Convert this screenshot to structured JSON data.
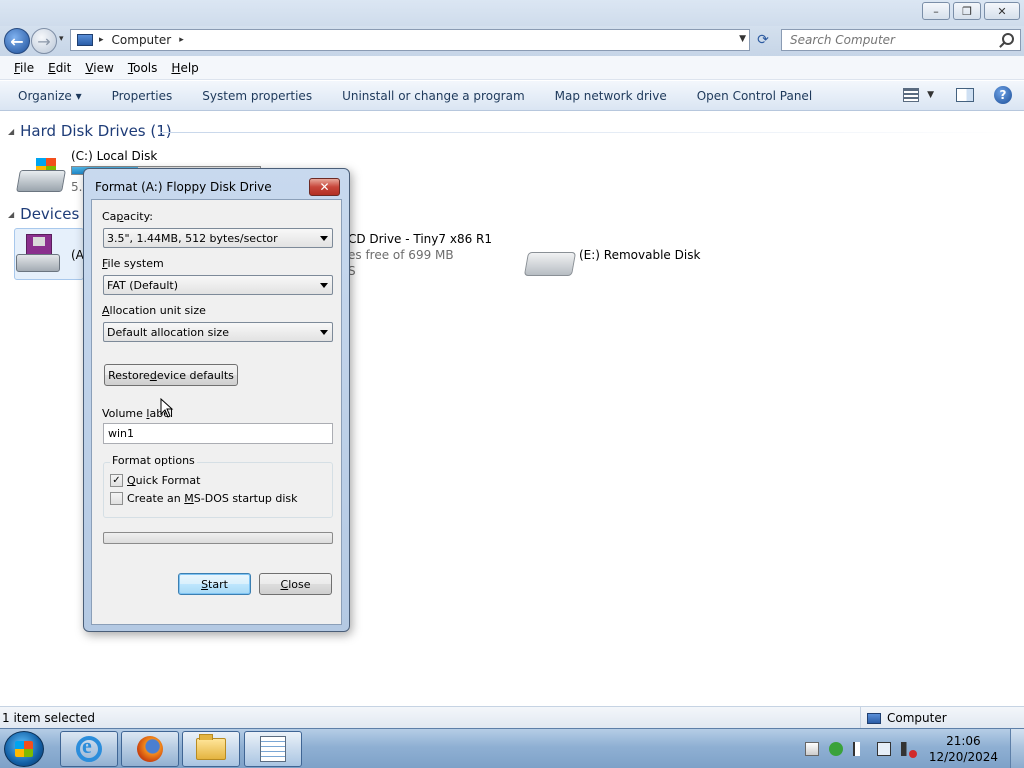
{
  "window": {
    "minimize_glyph": "–",
    "maximize_glyph": "❐",
    "close_glyph": "✕"
  },
  "address_bar": {
    "back_glyph": "←",
    "forward_glyph": "→",
    "path": [
      "Computer"
    ],
    "separator": "▸",
    "refresh_glyph": "⟳",
    "search_placeholder": "Search Computer"
  },
  "menu": {
    "items": [
      {
        "key": "F",
        "rest": "ile"
      },
      {
        "key": "E",
        "rest": "dit"
      },
      {
        "key": "V",
        "rest": "iew"
      },
      {
        "key": "T",
        "rest": "ools"
      },
      {
        "key": "H",
        "rest": "elp"
      }
    ]
  },
  "command_bar": {
    "organize": "Organize ▾",
    "items": [
      "Properties",
      "System properties",
      "Uninstall or change a program",
      "Map network drive",
      "Open Control Panel"
    ],
    "help_glyph": "?"
  },
  "content": {
    "group_hdd": "Hard Disk Drives (1)",
    "drive_c_name": "(C:) Local Disk",
    "drive_c_size_partial": "5.4",
    "drive_c_usage": 0.35,
    "group_devices_partial": "Devices w",
    "floppy_name_partial": "(A",
    "cd_name_partial": "CD Drive - Tiny7 x86 R1",
    "cd_free_partial": "es free of 699 MB",
    "cd_fs_partial": "S",
    "removable_name": "(E:) Removable Disk"
  },
  "dialog": {
    "title": "Format (A:) Floppy Disk Drive",
    "close_glyph": "✕",
    "capacity_label_pre": "Ca",
    "capacity_label_key": "p",
    "capacity_label_post": "acity:",
    "capacity_value": "3.5\",  1.44MB, 512 bytes/sector",
    "filesystem_label_key": "F",
    "filesystem_label_post": "ile system",
    "filesystem_value": "FAT (Default)",
    "alloc_label_key": "A",
    "alloc_label_post": "llocation unit size",
    "alloc_value": "Default allocation size",
    "restore_pre": "Restore ",
    "restore_key": "d",
    "restore_post": "evice defaults",
    "volume_label_pre": "Volume ",
    "volume_label_key": "l",
    "volume_label_post": "abel",
    "volume_value": "win1",
    "format_options_title": "Format options",
    "quick_format_pre": "",
    "quick_format_key": "Q",
    "quick_format_post": "uick Format",
    "quick_format_checked": true,
    "msdos_pre": "Create an ",
    "msdos_key": "M",
    "msdos_post": "S-DOS startup disk",
    "msdos_checked": false,
    "progress": 0,
    "start_key": "S",
    "start_post": "tart",
    "close_key": "C",
    "close_post": "lose",
    "check_glyph": "✓"
  },
  "status_bar": {
    "left": "1 item selected",
    "right": "Computer"
  },
  "taskbar": {
    "time": "21:06",
    "date": "12/20/2024"
  },
  "colors": {
    "accent": "#1e3c78",
    "drive_bar": "#1f86c6",
    "progress_fill": "#36b031"
  }
}
